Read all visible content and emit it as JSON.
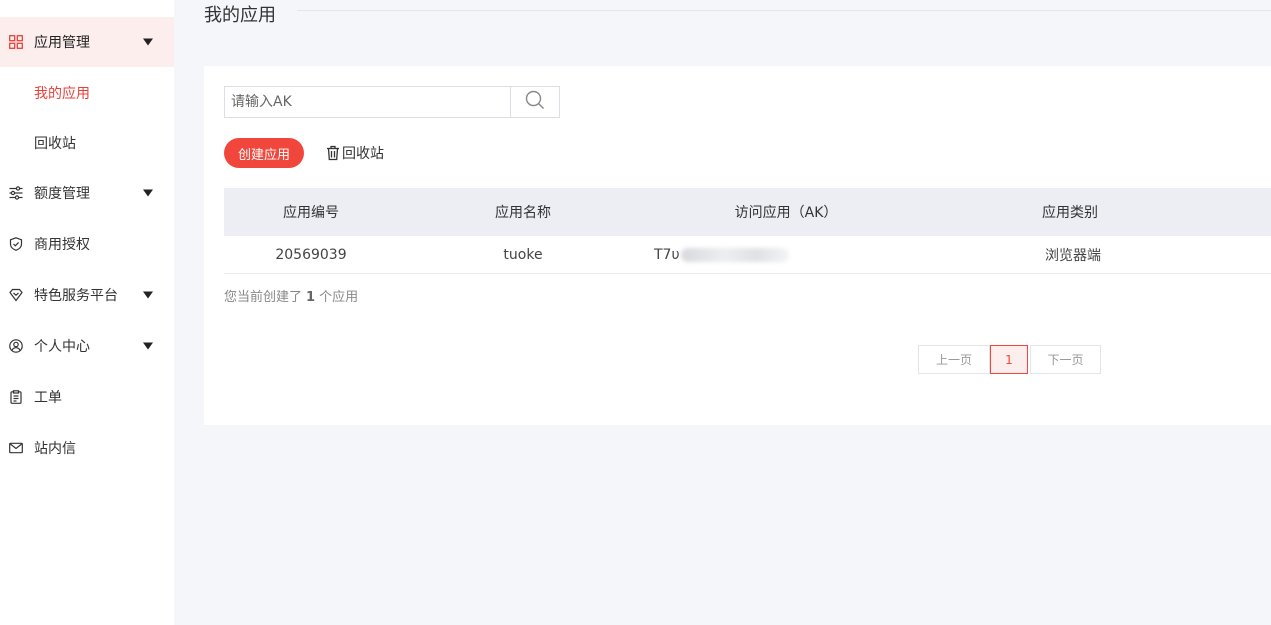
{
  "sidebar": {
    "items": [
      {
        "label": "应用管理",
        "icon": "grid-icon",
        "has_caret": true,
        "expanded": true
      },
      {
        "label": "额度管理",
        "icon": "sliders-icon",
        "has_caret": true
      },
      {
        "label": "商用授权",
        "icon": "shield-check-icon",
        "has_caret": false
      },
      {
        "label": "特色服务平台",
        "icon": "diamond-icon",
        "has_caret": true
      },
      {
        "label": "个人中心",
        "icon": "user-circle-icon",
        "has_caret": true
      },
      {
        "label": "工单",
        "icon": "clipboard-icon",
        "has_caret": false
      },
      {
        "label": "站内信",
        "icon": "mail-icon",
        "has_caret": false
      }
    ],
    "subitems": [
      {
        "label": "我的应用",
        "selected": true
      },
      {
        "label": "回收站",
        "selected": false
      }
    ]
  },
  "header": {
    "title": "我的应用"
  },
  "search": {
    "placeholder": "请输入AK",
    "value": ""
  },
  "actions": {
    "create_label": "创建应用",
    "recycle_label": "回收站"
  },
  "table": {
    "columns": [
      "应用编号",
      "应用名称",
      "访问应用（AK）",
      "应用类别"
    ],
    "rows": [
      {
        "id": "20569039",
        "name": "tuoke",
        "ak_visible": "T7υ",
        "category": "浏览器端"
      }
    ]
  },
  "summary": {
    "prefix": "您当前创建了",
    "count": "1",
    "suffix": "个应用"
  },
  "pagination": {
    "prev": "上一页",
    "current": "1",
    "next": "下一页"
  },
  "colors": {
    "accent": "#f0463c",
    "active_bg": "#fdeeee",
    "page_bg": "#f5f6fa"
  }
}
